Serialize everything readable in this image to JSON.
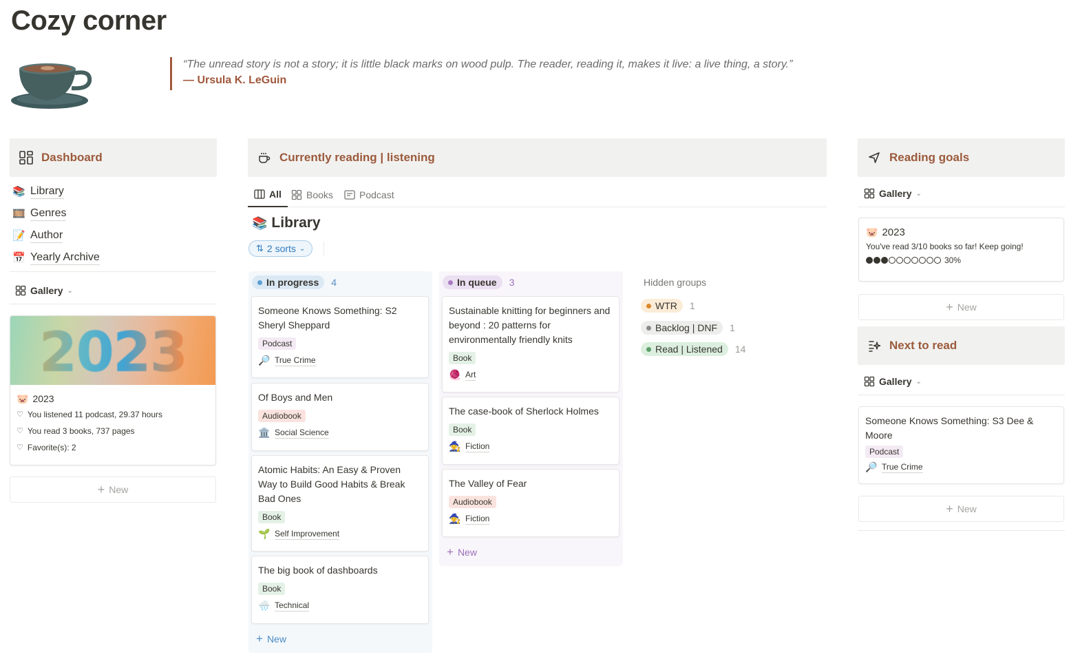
{
  "page": {
    "title": "Cozy corner"
  },
  "quote": {
    "text": "“The unread story is not a story; it is little black marks on wood pulp. The reader, reading it, makes it live: a live thing, a story.”",
    "author": "— Ursula K. LeGuin"
  },
  "dashboard": {
    "title": "Dashboard",
    "nav": [
      {
        "emoji": "📚",
        "label": "Library"
      },
      {
        "emoji": "🎞️",
        "label": "Genres"
      },
      {
        "emoji": "📝",
        "label": "Author"
      },
      {
        "emoji": "📅",
        "label": "Yearly Archive"
      }
    ],
    "view_label": "Gallery",
    "card": {
      "cover_text": "2023",
      "emoji": "🐷",
      "title": "2023",
      "lines": [
        "You listened 11 podcast, 29.37 hours",
        "You read 3 books, 737 pages",
        "Favorite(s): 2"
      ]
    },
    "new_label": "New"
  },
  "current": {
    "title": "Currently reading | listening",
    "tabs": [
      "All",
      "Books",
      "Podcast"
    ],
    "library_emoji": "📚",
    "library_title": "Library",
    "sort_label": "2 sorts",
    "groups": [
      {
        "name": "In progress",
        "count": "4",
        "dot": "#5a9fd4",
        "pill_bg": "#dbe9f5",
        "bg": "#f4f8fb",
        "count_color": "#5a8fc0",
        "new_color": "#4a8bc4",
        "cards": [
          {
            "title": "Someone Knows Something: S2 Sheryl Sheppard",
            "tag": "Podcast",
            "tag_class": "podcast",
            "genre_icon": "🔎",
            "genre": "True Crime"
          },
          {
            "title": "Of Boys and Men",
            "tag": "Audiobook",
            "tag_class": "audiobook",
            "genre_icon": "🏛️",
            "genre": "Social Science"
          },
          {
            "title": "Atomic Habits: An Easy & Proven Way to Build Good Habits & Break Bad Ones",
            "tag": "Book",
            "tag_class": "book",
            "genre_icon": "🌱",
            "genre": "Self Improvement"
          },
          {
            "title": "The big book of dashboards",
            "tag": "Book",
            "tag_class": "book",
            "genre_icon": "🌧️",
            "genre": "Technical"
          }
        ]
      },
      {
        "name": "In queue",
        "count": "3",
        "dot": "#a77bc2",
        "pill_bg": "#ebdff2",
        "bg": "#f9f6fb",
        "count_color": "#9b6fb8",
        "new_color": "#9b6fb8",
        "cards": [
          {
            "title": "Sustainable knitting for beginners and beyond : 20 patterns for environmentally friendly knits",
            "tag": "Book",
            "tag_class": "book",
            "genre_icon": "🧶",
            "genre": "Art"
          },
          {
            "title": "The case-book of Sherlock Holmes",
            "tag": "Book",
            "tag_class": "book",
            "genre_icon": "🧙",
            "genre": "Fiction"
          },
          {
            "title": "The Valley of Fear",
            "tag": "Audiobook",
            "tag_class": "audiobook",
            "genre_icon": "🧙",
            "genre": "Fiction"
          }
        ]
      }
    ],
    "new_label": "New",
    "hidden_label": "Hidden groups",
    "hidden_groups": [
      {
        "name": "WTR",
        "count": "1",
        "dot": "#d9892b",
        "bg": "#fbecd7"
      },
      {
        "name": "Backlog | DNF",
        "count": "1",
        "dot": "#8d8b87",
        "bg": "#ededeb"
      },
      {
        "name": "Read | Listened",
        "count": "14",
        "dot": "#5b9e6a",
        "bg": "#dcefdf"
      }
    ]
  },
  "goals": {
    "title": "Reading goals",
    "view_label": "Gallery",
    "card": {
      "emoji": "🐷",
      "title": "2023",
      "text": "You've read 3/10 books so far! Keep going!",
      "progress_filled": 3,
      "progress_total": 10,
      "progress_label": "30%"
    },
    "new_label": "New"
  },
  "next": {
    "title": "Next to read",
    "view_label": "Gallery",
    "card": {
      "title": "Someone Knows Something: S3 Dee & Moore",
      "tag": "Podcast",
      "genre_icon": "🔎",
      "genre": "True Crime"
    },
    "new_label": "New"
  }
}
